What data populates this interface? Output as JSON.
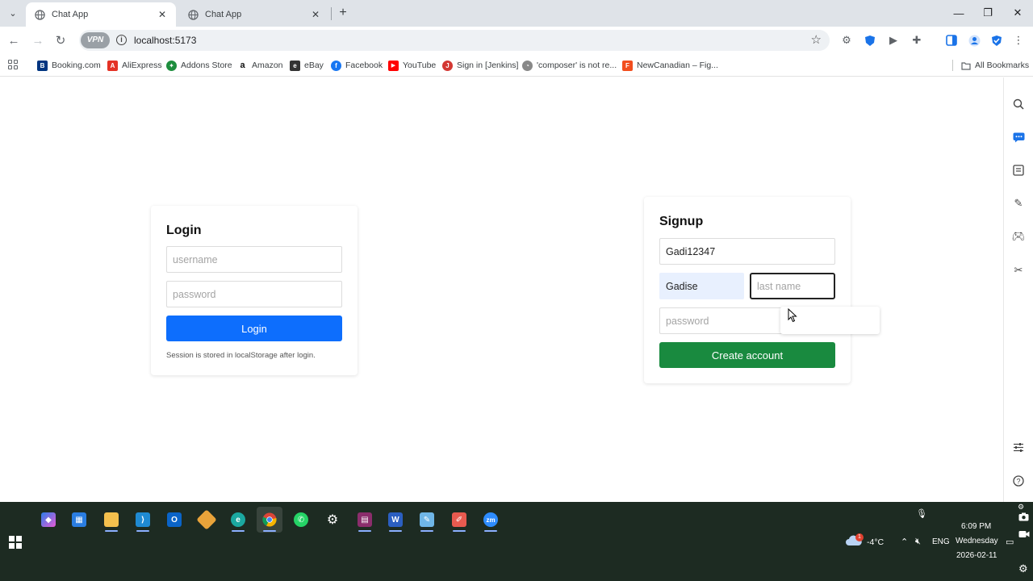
{
  "browser": {
    "tabs": [
      {
        "title": "Chat App",
        "active": true
      },
      {
        "title": "Chat App",
        "active": false
      }
    ],
    "address": {
      "vpn_label": "VPN",
      "url": "localhost:5173"
    },
    "bookmarks": [
      {
        "label": "Booking.com",
        "icon": "B",
        "color": "#003580"
      },
      {
        "label": "AliExpress",
        "icon": "A",
        "color": "#e43225"
      },
      {
        "label": "Addons Store",
        "icon": "✦",
        "color": "#1e8e3e"
      },
      {
        "label": "Amazon",
        "icon": "a",
        "color": "#ffffff"
      },
      {
        "label": "eBay",
        "icon": "e",
        "color": "#333333"
      },
      {
        "label": "Facebook",
        "icon": "f",
        "color": "#1877f2"
      },
      {
        "label": "YouTube",
        "icon": "▶",
        "color": "#ff0000"
      },
      {
        "label": "Sign in [Jenkins]",
        "icon": "J",
        "color": "#d33833"
      },
      {
        "label": "'composer' is not re...",
        "icon": "◔",
        "color": "#888888"
      },
      {
        "label": "NewCanadian – Fig...",
        "icon": "F",
        "color": "#f24e1e"
      }
    ],
    "all_bookmarks_label": "All Bookmarks"
  },
  "login": {
    "title": "Login",
    "username_placeholder": "username",
    "password_placeholder": "password",
    "button_label": "Login",
    "note": "Session is stored in localStorage after login."
  },
  "signup": {
    "title": "Signup",
    "username_value": "Gadi12347",
    "first_name_value": "Gadise",
    "last_name_placeholder": "last name",
    "password_placeholder": "password",
    "button_label": "Create account"
  },
  "taskbar": {
    "weather_temp": "-4°C",
    "weather_badge": "1",
    "language": "ENG",
    "time": "6:09 PM",
    "day": "Wednesday",
    "date": "2026-02-11"
  },
  "colors": {
    "login_button": "#0d6efd",
    "signup_button": "#198a3f",
    "taskbar": "#1d2b22"
  }
}
